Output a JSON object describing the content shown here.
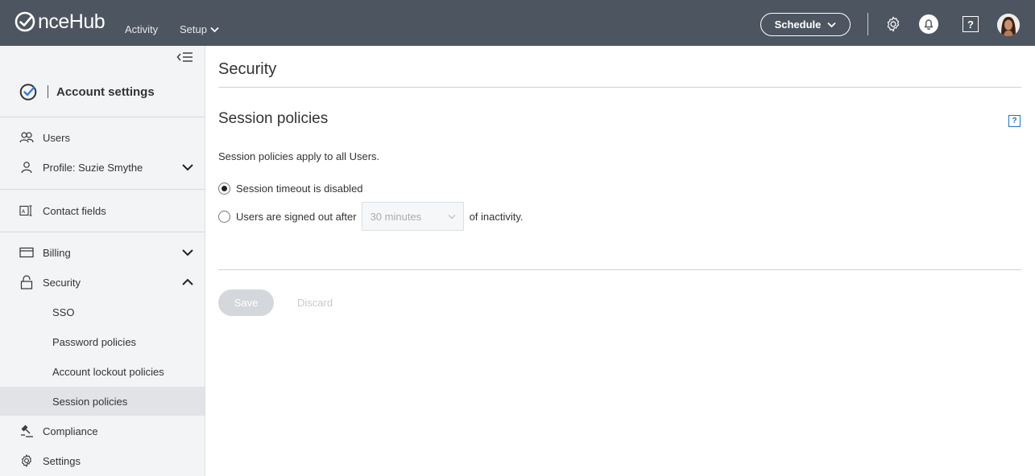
{
  "topbar": {
    "brand": "nceHub",
    "nav": [
      "Activity",
      "Setup"
    ],
    "schedule_label": "Schedule",
    "help_glyph": "?",
    "icons": [
      "gear-icon",
      "bell-icon",
      "help-icon",
      "avatar"
    ]
  },
  "sidebar": {
    "heading": "Account settings",
    "items": {
      "users": "Users",
      "profile": "Profile: Suzie Smythe",
      "contact_fields": "Contact fields",
      "billing": "Billing",
      "security": "Security",
      "sso": "SSO",
      "password_policies": "Password policies",
      "account_lockout": "Account lockout policies",
      "session_policies": "Session policies",
      "compliance": "Compliance",
      "settings": "Settings"
    },
    "active_item": "Session policies"
  },
  "main": {
    "page_title": "Security",
    "section_title": "Session policies",
    "help_glyph": "?",
    "description": "Session policies apply to all Users.",
    "option_disabled": "Session timeout is disabled",
    "option_signout_prefix": "Users are signed out after",
    "signout_value": "30 minutes",
    "option_signout_suffix": "of inactivity.",
    "selected_option": "Session timeout is disabled",
    "save_label": "Save",
    "discard_label": "Discard"
  },
  "colors": {
    "topbar_bg": "#4d5560",
    "sidebar_bg": "#f3f4f5",
    "active_item_bg": "#e1e3e6",
    "link_blue": "#1e74c6",
    "disabled_button": "#d4d7db"
  }
}
